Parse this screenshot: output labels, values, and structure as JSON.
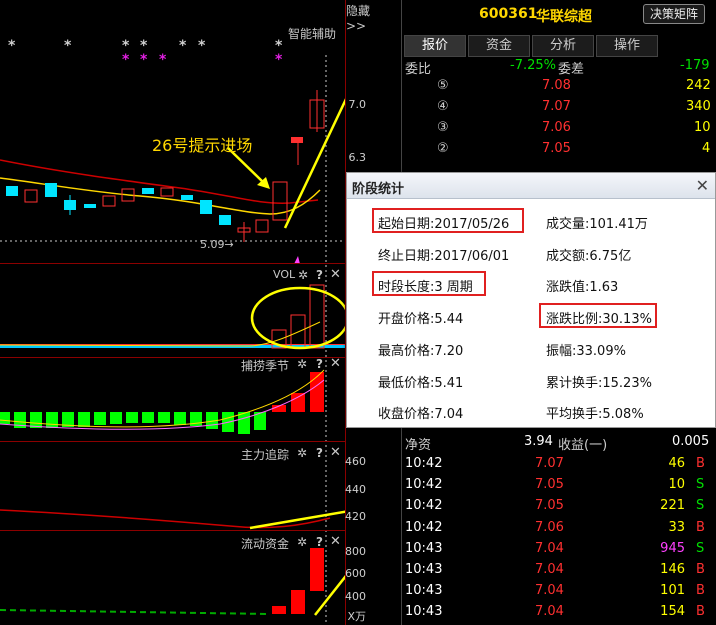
{
  "chart": {
    "hide_label": "隐藏>>",
    "assist_label": "智能辅助",
    "annotation_text": "26号提示进场",
    "low_price_label": "5.09→",
    "price_axis": [
      "7.0",
      "6.3"
    ],
    "vol_label": "VOL",
    "indicator1_label": "捕捞季节",
    "indicator2_label": "主力追踪",
    "indicator2_axis": [
      "460",
      "440",
      "420"
    ],
    "indicator3_label": "流动资金",
    "indicator3_axis": [
      "800",
      "600",
      "400"
    ],
    "unit_label": "X万",
    "gear_glyph": "✲",
    "q_glyph": "?",
    "x_glyph": "✕"
  },
  "panel": {
    "code": "600361",
    "name": "华联综超",
    "matrix_button": "决策矩阵",
    "tabs": [
      "报价",
      "资金",
      "分析",
      "操作"
    ],
    "weibi_label": "委比",
    "weibi_value": "-7.25%",
    "weicha_label": "委差",
    "weicha_value": "-179",
    "asks": [
      {
        "level": "⑤",
        "price": "7.08",
        "vol": "242"
      },
      {
        "level": "④",
        "price": "7.07",
        "vol": "340"
      },
      {
        "level": "③",
        "price": "7.06",
        "vol": "10"
      },
      {
        "level": "②",
        "price": "7.05",
        "vol": "4"
      }
    ],
    "net_asset_label": "净资",
    "net_asset_value": "3.94",
    "income_label": "收益(一)",
    "income_value": "0.005",
    "ticks": [
      {
        "time": "10:42",
        "price": "7.07",
        "vol": "46",
        "side": "B"
      },
      {
        "time": "10:42",
        "price": "7.05",
        "vol": "10",
        "side": "S"
      },
      {
        "time": "10:42",
        "price": "7.05",
        "vol": "221",
        "side": "S"
      },
      {
        "time": "10:42",
        "price": "7.06",
        "vol": "33",
        "side": "B"
      },
      {
        "time": "10:43",
        "price": "7.04",
        "vol": "945",
        "side": "S"
      },
      {
        "time": "10:43",
        "price": "7.04",
        "vol": "146",
        "side": "B"
      },
      {
        "time": "10:43",
        "price": "7.04",
        "vol": "101",
        "side": "B"
      },
      {
        "time": "10:43",
        "price": "7.04",
        "vol": "154",
        "side": "B"
      }
    ]
  },
  "dialog": {
    "title": "阶段统计",
    "start_date": "起始日期:2017/05/26",
    "end_date": "终止日期:2017/06/01",
    "period": "时段长度:3 周期",
    "open_price": "开盘价格:5.44",
    "high_price": "最高价格:7.20",
    "low_price": "最低价格:5.41",
    "close_price": "收盘价格:7.04",
    "volume": "成交量:101.41万",
    "amount": "成交额:6.75亿",
    "change_value": "涨跌值:1.63",
    "change_pct": "涨跌比例:30.13%",
    "amplitude": "振幅:33.09%",
    "cum_turnover": "累计换手:15.23%",
    "avg_turnover": "平均换手:5.08%"
  },
  "colors": {
    "up": "#ff3030",
    "down": "#00ffff",
    "highlight": "#e02020",
    "arrow": "#ffff00",
    "ma_yellow": "#ffd700",
    "ma_red": "#cc0000"
  }
}
